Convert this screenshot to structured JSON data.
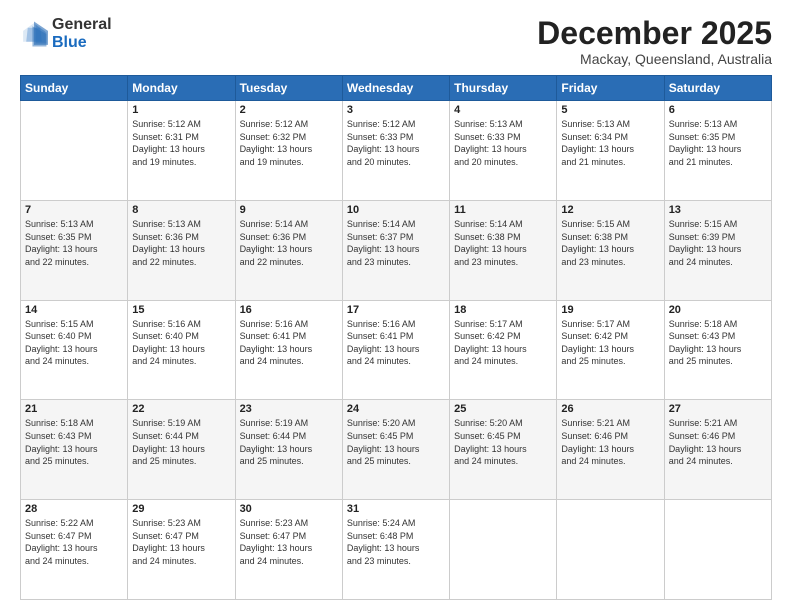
{
  "logo": {
    "general": "General",
    "blue": "Blue"
  },
  "header": {
    "month": "December 2025",
    "location": "Mackay, Queensland, Australia"
  },
  "weekdays": [
    "Sunday",
    "Monday",
    "Tuesday",
    "Wednesday",
    "Thursday",
    "Friday",
    "Saturday"
  ],
  "weeks": [
    [
      {
        "day": "",
        "sunrise": "",
        "sunset": "",
        "daylight": ""
      },
      {
        "day": "1",
        "sunrise": "Sunrise: 5:12 AM",
        "sunset": "Sunset: 6:31 PM",
        "daylight": "Daylight: 13 hours and 19 minutes."
      },
      {
        "day": "2",
        "sunrise": "Sunrise: 5:12 AM",
        "sunset": "Sunset: 6:32 PM",
        "daylight": "Daylight: 13 hours and 19 minutes."
      },
      {
        "day": "3",
        "sunrise": "Sunrise: 5:12 AM",
        "sunset": "Sunset: 6:33 PM",
        "daylight": "Daylight: 13 hours and 20 minutes."
      },
      {
        "day": "4",
        "sunrise": "Sunrise: 5:13 AM",
        "sunset": "Sunset: 6:33 PM",
        "daylight": "Daylight: 13 hours and 20 minutes."
      },
      {
        "day": "5",
        "sunrise": "Sunrise: 5:13 AM",
        "sunset": "Sunset: 6:34 PM",
        "daylight": "Daylight: 13 hours and 21 minutes."
      },
      {
        "day": "6",
        "sunrise": "Sunrise: 5:13 AM",
        "sunset": "Sunset: 6:35 PM",
        "daylight": "Daylight: 13 hours and 21 minutes."
      }
    ],
    [
      {
        "day": "7",
        "sunrise": "Sunrise: 5:13 AM",
        "sunset": "Sunset: 6:35 PM",
        "daylight": "Daylight: 13 hours and 22 minutes."
      },
      {
        "day": "8",
        "sunrise": "Sunrise: 5:13 AM",
        "sunset": "Sunset: 6:36 PM",
        "daylight": "Daylight: 13 hours and 22 minutes."
      },
      {
        "day": "9",
        "sunrise": "Sunrise: 5:14 AM",
        "sunset": "Sunset: 6:36 PM",
        "daylight": "Daylight: 13 hours and 22 minutes."
      },
      {
        "day": "10",
        "sunrise": "Sunrise: 5:14 AM",
        "sunset": "Sunset: 6:37 PM",
        "daylight": "Daylight: 13 hours and 23 minutes."
      },
      {
        "day": "11",
        "sunrise": "Sunrise: 5:14 AM",
        "sunset": "Sunset: 6:38 PM",
        "daylight": "Daylight: 13 hours and 23 minutes."
      },
      {
        "day": "12",
        "sunrise": "Sunrise: 5:15 AM",
        "sunset": "Sunset: 6:38 PM",
        "daylight": "Daylight: 13 hours and 23 minutes."
      },
      {
        "day": "13",
        "sunrise": "Sunrise: 5:15 AM",
        "sunset": "Sunset: 6:39 PM",
        "daylight": "Daylight: 13 hours and 24 minutes."
      }
    ],
    [
      {
        "day": "14",
        "sunrise": "Sunrise: 5:15 AM",
        "sunset": "Sunset: 6:40 PM",
        "daylight": "Daylight: 13 hours and 24 minutes."
      },
      {
        "day": "15",
        "sunrise": "Sunrise: 5:16 AM",
        "sunset": "Sunset: 6:40 PM",
        "daylight": "Daylight: 13 hours and 24 minutes."
      },
      {
        "day": "16",
        "sunrise": "Sunrise: 5:16 AM",
        "sunset": "Sunset: 6:41 PM",
        "daylight": "Daylight: 13 hours and 24 minutes."
      },
      {
        "day": "17",
        "sunrise": "Sunrise: 5:16 AM",
        "sunset": "Sunset: 6:41 PM",
        "daylight": "Daylight: 13 hours and 24 minutes."
      },
      {
        "day": "18",
        "sunrise": "Sunrise: 5:17 AM",
        "sunset": "Sunset: 6:42 PM",
        "daylight": "Daylight: 13 hours and 24 minutes."
      },
      {
        "day": "19",
        "sunrise": "Sunrise: 5:17 AM",
        "sunset": "Sunset: 6:42 PM",
        "daylight": "Daylight: 13 hours and 25 minutes."
      },
      {
        "day": "20",
        "sunrise": "Sunrise: 5:18 AM",
        "sunset": "Sunset: 6:43 PM",
        "daylight": "Daylight: 13 hours and 25 minutes."
      }
    ],
    [
      {
        "day": "21",
        "sunrise": "Sunrise: 5:18 AM",
        "sunset": "Sunset: 6:43 PM",
        "daylight": "Daylight: 13 hours and 25 minutes."
      },
      {
        "day": "22",
        "sunrise": "Sunrise: 5:19 AM",
        "sunset": "Sunset: 6:44 PM",
        "daylight": "Daylight: 13 hours and 25 minutes."
      },
      {
        "day": "23",
        "sunrise": "Sunrise: 5:19 AM",
        "sunset": "Sunset: 6:44 PM",
        "daylight": "Daylight: 13 hours and 25 minutes."
      },
      {
        "day": "24",
        "sunrise": "Sunrise: 5:20 AM",
        "sunset": "Sunset: 6:45 PM",
        "daylight": "Daylight: 13 hours and 25 minutes."
      },
      {
        "day": "25",
        "sunrise": "Sunrise: 5:20 AM",
        "sunset": "Sunset: 6:45 PM",
        "daylight": "Daylight: 13 hours and 24 minutes."
      },
      {
        "day": "26",
        "sunrise": "Sunrise: 5:21 AM",
        "sunset": "Sunset: 6:46 PM",
        "daylight": "Daylight: 13 hours and 24 minutes."
      },
      {
        "day": "27",
        "sunrise": "Sunrise: 5:21 AM",
        "sunset": "Sunset: 6:46 PM",
        "daylight": "Daylight: 13 hours and 24 minutes."
      }
    ],
    [
      {
        "day": "28",
        "sunrise": "Sunrise: 5:22 AM",
        "sunset": "Sunset: 6:47 PM",
        "daylight": "Daylight: 13 hours and 24 minutes."
      },
      {
        "day": "29",
        "sunrise": "Sunrise: 5:23 AM",
        "sunset": "Sunset: 6:47 PM",
        "daylight": "Daylight: 13 hours and 24 minutes."
      },
      {
        "day": "30",
        "sunrise": "Sunrise: 5:23 AM",
        "sunset": "Sunset: 6:47 PM",
        "daylight": "Daylight: 13 hours and 24 minutes."
      },
      {
        "day": "31",
        "sunrise": "Sunrise: 5:24 AM",
        "sunset": "Sunset: 6:48 PM",
        "daylight": "Daylight: 13 hours and 23 minutes."
      },
      {
        "day": "",
        "sunrise": "",
        "sunset": "",
        "daylight": ""
      },
      {
        "day": "",
        "sunrise": "",
        "sunset": "",
        "daylight": ""
      },
      {
        "day": "",
        "sunrise": "",
        "sunset": "",
        "daylight": ""
      }
    ]
  ]
}
